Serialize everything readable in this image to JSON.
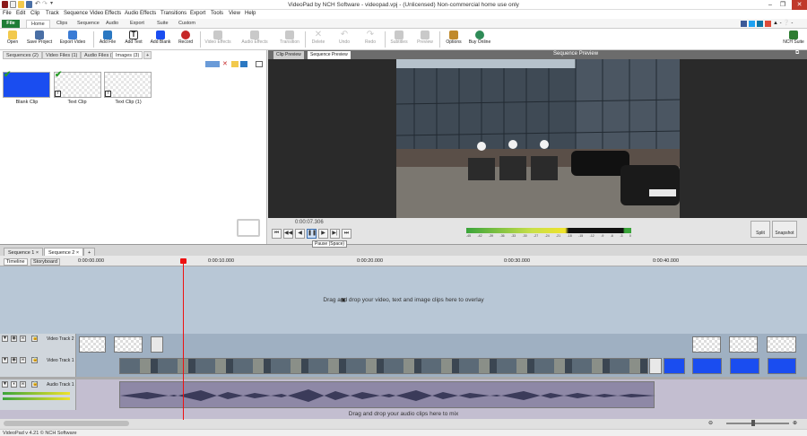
{
  "title": "VideoPad by NCH Software - videopad.vpj - (Unlicensed) Non-commercial home use only",
  "menu": [
    "File",
    "Edit",
    "Clip",
    "Track",
    "Sequence",
    "Video Effects",
    "Audio Effects",
    "Transitions",
    "Export",
    "Tools",
    "View",
    "Help"
  ],
  "ribbon_tabs": [
    "File",
    "Home",
    "Clips",
    "Sequence",
    "Audio",
    "Export",
    "Suite",
    "Custom"
  ],
  "ribbon_buttons": {
    "open": "Open",
    "save_project": "Save Project",
    "export_video": "Export Video",
    "add_file": "Add File",
    "add_text": "Add Text",
    "add_blank": "Add Blank",
    "record": "Record",
    "video_effects": "Video Effects",
    "audio_effects": "Audio Effects",
    "transition": "Transition",
    "delete": "Delete",
    "undo": "Undo",
    "redo": "Redo",
    "subtitles": "Subtitles",
    "preview": "Preview",
    "options": "Options",
    "buy_online": "Buy Online",
    "nch_suite": "NCH Suite"
  },
  "bin_tabs": [
    "Sequences",
    "Video Files",
    "Audio Files",
    "Images"
  ],
  "bin_tab_counts": [
    "(2)",
    "(1)",
    "(1)",
    "(3)"
  ],
  "clips": [
    {
      "label": "Blank Clip",
      "color": "#1a4df0"
    },
    {
      "label": "Text Clip",
      "color": "#dcdcdc"
    },
    {
      "label": "Text Clip (1)",
      "color": "#dcdcdc"
    }
  ],
  "preview": {
    "tab_clip": "Clip Preview",
    "tab_sequence": "Sequence Preview",
    "header": "Sequence Preview",
    "timecode": "0:00:07.306",
    "tooltip": "Pause (Space)",
    "split": "Split",
    "snapshot": "Snapshot",
    "meter_labels": [
      "-45",
      "-42",
      "-39",
      "-36",
      "-33",
      "-30",
      "-27",
      "-24",
      "-21",
      "-18",
      "-15",
      "-12",
      "-9",
      "-6",
      "-3",
      "0"
    ]
  },
  "sequence_tabs": [
    "Sequence 1",
    "Sequence 2"
  ],
  "timeline": {
    "tab_timeline": "Timeline",
    "tab_storyboard": "Storyboard",
    "ticks": [
      "0:00:00.000",
      "0:00:10.000",
      "0:00:20.000",
      "0:00:30.000",
      "0:00:40.000"
    ],
    "overlay_msg": "Drag and drop your video, text and image clips here to overlay",
    "video_track_2": "Video Track 2",
    "video_track_1": "Video Track 1",
    "audio_track_1": "Audio Track 1",
    "audio_msg": "Drag and drop your audio clips here to mix"
  },
  "status": "VideoPad v 4.21 © NCH Software",
  "colors": {
    "file_tab": "#1e7d36",
    "blank_clip": "#1a4df0",
    "overlay": "#b8c7d6",
    "audio_bg": "#c3bed0",
    "playhead": "#ee1111"
  }
}
